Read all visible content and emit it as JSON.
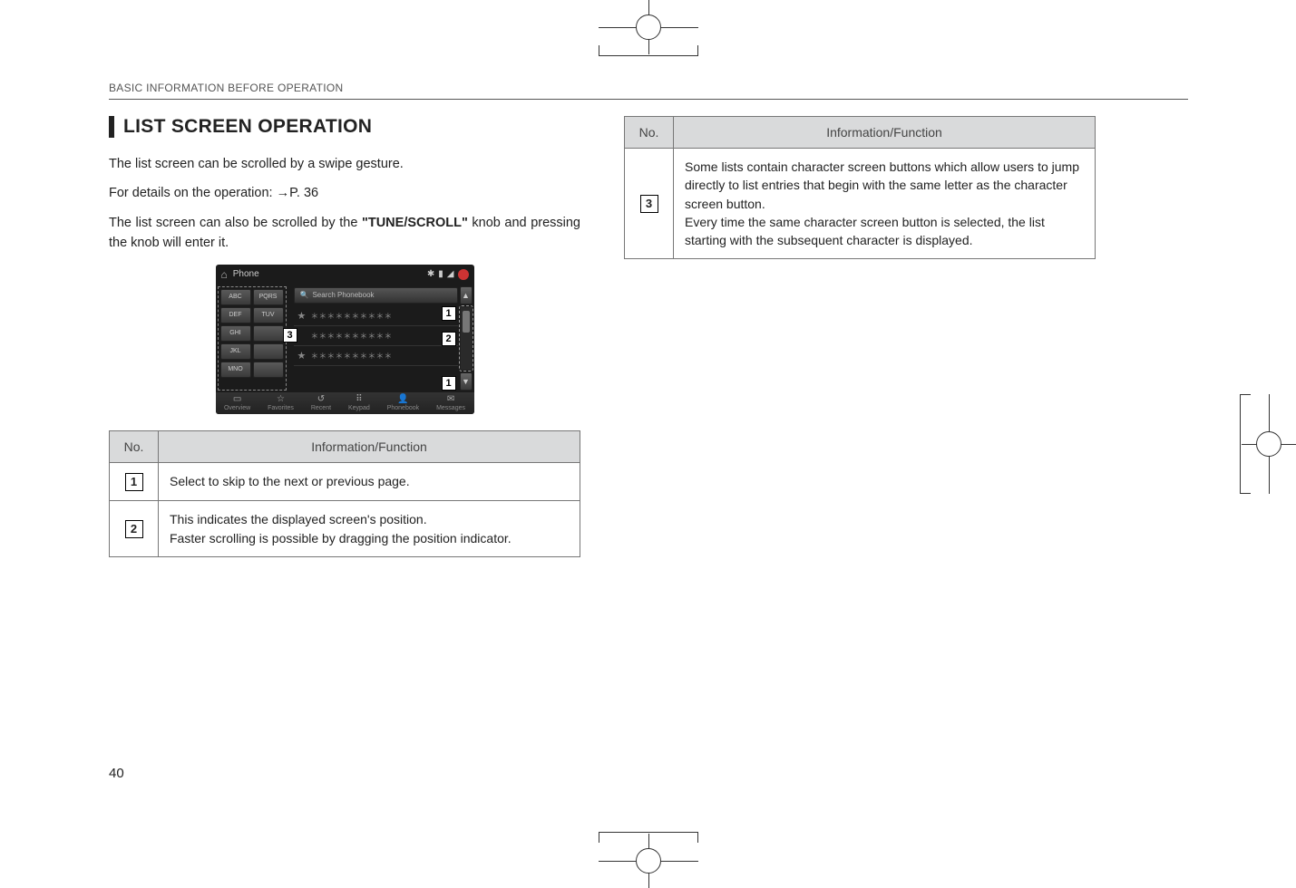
{
  "running_head": "BASIC INFORMATION BEFORE OPERATION",
  "section_title": "LIST SCREEN OPERATION",
  "para1": "The list screen can be scrolled by a swipe gesture.",
  "para2": "For details on the operation: →P. 36",
  "para3_a": "The list screen can also be scrolled by the ",
  "para3_bold": "\"TUNE/SCROLL\"",
  "para3_b": " knob and pressing the knob will enter it.",
  "page_number": "40",
  "screenshot": {
    "title": "Phone",
    "search_label": "Search Phonebook",
    "keys": [
      "ABC",
      "PQRS",
      "DEF",
      "TUV",
      "GHI",
      "",
      "JKL",
      "",
      "MNO",
      ""
    ],
    "bottom_items": [
      {
        "label": "Overview",
        "icon": "▭"
      },
      {
        "label": "Favorites",
        "icon": "☆"
      },
      {
        "label": "Recent",
        "icon": "↺"
      },
      {
        "label": "Keypad",
        "icon": "⠿"
      },
      {
        "label": "Phonebook",
        "icon": "👤"
      },
      {
        "label": "Messages",
        "icon": "✉"
      }
    ],
    "row_placeholder": "＊＊＊＊＊＊＊＊＊＊"
  },
  "table_left": {
    "col_no": "No.",
    "col_info": "Information/Function",
    "rows": [
      {
        "n": "1",
        "text": "Select to skip to the next or previous page."
      },
      {
        "n": "2",
        "text": "This indicates the displayed screen's position.\nFaster scrolling is possible by dragging the position indicator."
      }
    ]
  },
  "table_right": {
    "col_no": "No.",
    "col_info": "Information/Function",
    "rows": [
      {
        "n": "3",
        "text": "Some lists contain character screen buttons which allow users to jump directly to list entries that begin with the same letter as the character screen button.\nEvery time the same character screen button is selected, the list starting with the subsequent character is displayed."
      }
    ]
  }
}
